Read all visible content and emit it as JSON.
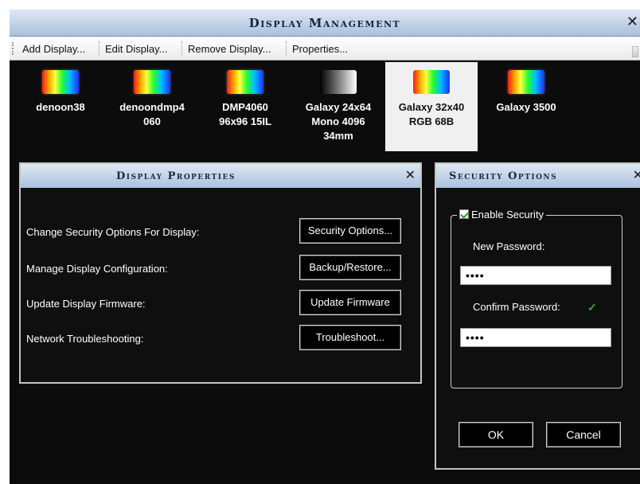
{
  "window": {
    "title": "Display Management",
    "close_glyph": "✕"
  },
  "menu": {
    "items": [
      "Add Display...",
      "Edit Display...",
      "Remove Display...",
      "Properties..."
    ]
  },
  "displays": [
    {
      "name": "denoon38",
      "thumb": "rgb"
    },
    {
      "name": "denoondmp4\n060",
      "thumb": "rgb"
    },
    {
      "name": "DMP4060\n96x96 15IL",
      "thumb": "rgb"
    },
    {
      "name": "Galaxy 24x64\nMono 4096\n34mm",
      "thumb": "mono"
    },
    {
      "name": "Galaxy 32x40\nRGB 68B",
      "thumb": "rgb",
      "selected": true
    },
    {
      "name": "Galaxy 3500",
      "thumb": "rgb"
    }
  ],
  "display_properties": {
    "title": "Display Properties",
    "close_glyph": "✕",
    "rows": [
      {
        "label": "Change Security Options For Display:",
        "button": "Security Options..."
      },
      {
        "label": "Manage Display Configuration:",
        "button": "Backup/Restore..."
      },
      {
        "label": "Update Display Firmware:",
        "button": "Update Firmware"
      },
      {
        "label": "Network Troubleshooting:",
        "button": "Troubleshoot..."
      }
    ]
  },
  "security": {
    "title": "Security Options",
    "close_glyph": "✕",
    "enable_label": "Enable Security",
    "enabled": true,
    "new_password_label": "New Password:",
    "new_password_value": "••••",
    "confirm_password_label": "Confirm Password:",
    "confirm_password_value": "••••",
    "match_glyph": "✓",
    "ok_label": "OK",
    "cancel_label": "Cancel"
  },
  "colors": {
    "titlebar_gradient": [
      "#dfe8f3",
      "#a9c0dc"
    ],
    "background": "#0c0c0c",
    "panel_border": "#c4c4c4",
    "check_green": "#3aa83a"
  }
}
